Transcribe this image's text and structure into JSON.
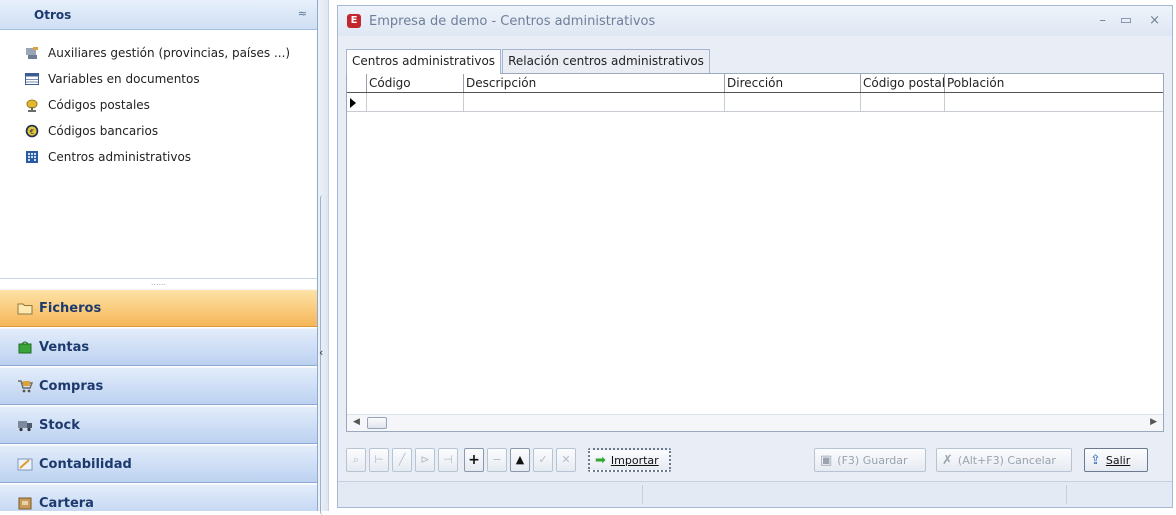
{
  "sidebar": {
    "section_title": "Otros",
    "collapse_glyph": "≈",
    "items": [
      {
        "label": "Auxiliares gestión (provincias, países ...)",
        "icon": "tools-icon"
      },
      {
        "label": "Variables en documentos",
        "icon": "table-icon"
      },
      {
        "label": "Códigos postales",
        "icon": "mailbox-icon"
      },
      {
        "label": "Códigos bancarios",
        "icon": "euro-coin-icon"
      },
      {
        "label": "Centros administrativos",
        "icon": "building-icon"
      }
    ],
    "splitter_grip": "......",
    "groups": [
      {
        "label": "Ficheros",
        "icon": "folder-icon",
        "active": true
      },
      {
        "label": "Ventas",
        "icon": "shopping-bag-icon",
        "active": false
      },
      {
        "label": "Compras",
        "icon": "cart-icon",
        "active": false
      },
      {
        "label": "Stock",
        "icon": "truck-icon",
        "active": false
      },
      {
        "label": "Contabilidad",
        "icon": "ledger-icon",
        "active": false
      },
      {
        "label": "Cartera",
        "icon": "wallet-icon",
        "active": false
      }
    ],
    "collapse_arrow": "‹"
  },
  "window": {
    "app_icon_letter": "E",
    "title": "Empresa de demo - Centros administrativos",
    "controls": {
      "minimize": "–",
      "maximize": "▭",
      "close": "×"
    },
    "tabs": [
      {
        "label": "Centros administrativos",
        "active": true
      },
      {
        "label": "Relación centros administrativos",
        "active": false
      }
    ],
    "grid": {
      "columns": [
        "Código",
        "Descripción",
        "Dirección",
        "Código postal",
        "Población"
      ],
      "rows": [
        [
          "",
          "",
          "",
          "",
          ""
        ]
      ]
    },
    "toolbar": {
      "import_label": "Importar",
      "save_label": "(F3) Guardar",
      "cancel_label": "(Alt+F3) Cancelar",
      "exit_label": "Salir"
    }
  },
  "colors": {
    "accent_active_group": "#f6b659",
    "group_bg": "#bcd1f0",
    "app_icon": "#c4262e",
    "import_arrow": "#2ea82e"
  }
}
